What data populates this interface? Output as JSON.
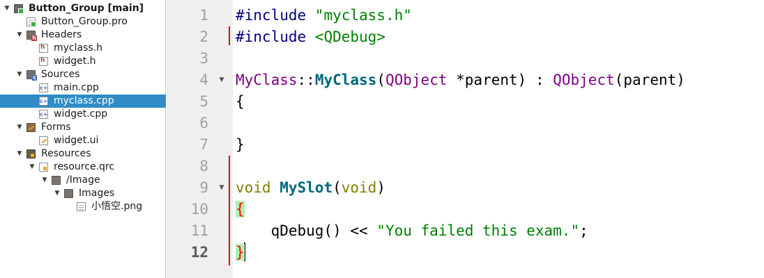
{
  "project_tree": {
    "items": [
      {
        "label": "Button_Group [main]",
        "depth": 0,
        "arrow": "open",
        "icon": "qt-project-folder-icon",
        "bold": true,
        "selected": false
      },
      {
        "label": "Button_Group.pro",
        "depth": 1,
        "arrow": "none",
        "icon": "pro-file-icon",
        "bold": false,
        "selected": false
      },
      {
        "label": "Headers",
        "depth": 1,
        "arrow": "open",
        "icon": "headers-folder-icon",
        "bold": false,
        "selected": false
      },
      {
        "label": "myclass.h",
        "depth": 2,
        "arrow": "none",
        "icon": "header-file-icon",
        "bold": false,
        "selected": false
      },
      {
        "label": "widget.h",
        "depth": 2,
        "arrow": "none",
        "icon": "header-file-icon",
        "bold": false,
        "selected": false
      },
      {
        "label": "Sources",
        "depth": 1,
        "arrow": "open",
        "icon": "sources-folder-icon",
        "bold": false,
        "selected": false
      },
      {
        "label": "main.cpp",
        "depth": 2,
        "arrow": "none",
        "icon": "cpp-file-icon",
        "bold": false,
        "selected": false
      },
      {
        "label": "myclass.cpp",
        "depth": 2,
        "arrow": "none",
        "icon": "cpp-file-icon",
        "bold": false,
        "selected": true
      },
      {
        "label": "widget.cpp",
        "depth": 2,
        "arrow": "none",
        "icon": "cpp-file-icon",
        "bold": false,
        "selected": false
      },
      {
        "label": "Forms",
        "depth": 1,
        "arrow": "open",
        "icon": "forms-folder-icon",
        "bold": false,
        "selected": false
      },
      {
        "label": "widget.ui",
        "depth": 2,
        "arrow": "none",
        "icon": "ui-file-icon",
        "bold": false,
        "selected": false
      },
      {
        "label": "Resources",
        "depth": 1,
        "arrow": "open",
        "icon": "resources-folder-icon",
        "bold": false,
        "selected": false
      },
      {
        "label": "resource.qrc",
        "depth": 2,
        "arrow": "open",
        "icon": "qrc-file-icon",
        "bold": false,
        "selected": false
      },
      {
        "label": "/Image",
        "depth": 3,
        "arrow": "open",
        "icon": "folder-icon",
        "bold": false,
        "selected": false
      },
      {
        "label": "Images",
        "depth": 4,
        "arrow": "open",
        "icon": "folder-icon",
        "bold": false,
        "selected": false
      },
      {
        "label": "小悟空.png",
        "depth": 5,
        "arrow": "none",
        "icon": "image-file-icon",
        "bold": false,
        "selected": false
      }
    ]
  },
  "editor": {
    "line_numbers": [
      "1",
      "2",
      "3",
      "4",
      "5",
      "6",
      "7",
      "8",
      "9",
      "10",
      "11",
      "12"
    ],
    "current_line": "12",
    "fold_markers_on_lines": [
      "4",
      "9"
    ],
    "lines": [
      [
        {
          "t": "#include ",
          "c": "pre"
        },
        {
          "t": "\"myclass.h\"",
          "c": "str"
        }
      ],
      [
        {
          "t": "#include ",
          "c": "pre"
        },
        {
          "t": "<QDebug>",
          "c": "str"
        }
      ],
      [],
      [
        {
          "t": "MyClass",
          "c": "type"
        },
        {
          "t": "::",
          "c": "op"
        },
        {
          "t": "MyClass",
          "c": "bold"
        },
        {
          "t": "(",
          "c": "par"
        },
        {
          "t": "QObject",
          "c": "type"
        },
        {
          "t": " *parent",
          "c": "par"
        },
        {
          "t": ") : ",
          "c": "par"
        },
        {
          "t": "QObject",
          "c": "type"
        },
        {
          "t": "(parent)",
          "c": "par"
        }
      ],
      [
        {
          "t": "{",
          "c": "par"
        }
      ],
      [],
      [
        {
          "t": "}",
          "c": "par"
        }
      ],
      [],
      [
        {
          "t": "void",
          "c": "kw"
        },
        {
          "t": " ",
          "c": "par"
        },
        {
          "t": "MySlot",
          "c": "bold"
        },
        {
          "t": "(",
          "c": "par"
        },
        {
          "t": "void",
          "c": "kw"
        },
        {
          "t": ")",
          "c": "par"
        }
      ],
      [
        {
          "t": "{",
          "c": "brace"
        }
      ],
      [
        {
          "t": "    qDebug() << ",
          "c": "par"
        },
        {
          "t": "\"You failed this exam.\"",
          "c": "str"
        },
        {
          "t": ";",
          "c": "par"
        }
      ],
      [
        {
          "t": "}",
          "c": "brace"
        }
      ]
    ]
  },
  "colors": {
    "selection": "#308cc6",
    "revision_marker": "#c8102e",
    "brace_match": "#b4eeb4"
  }
}
